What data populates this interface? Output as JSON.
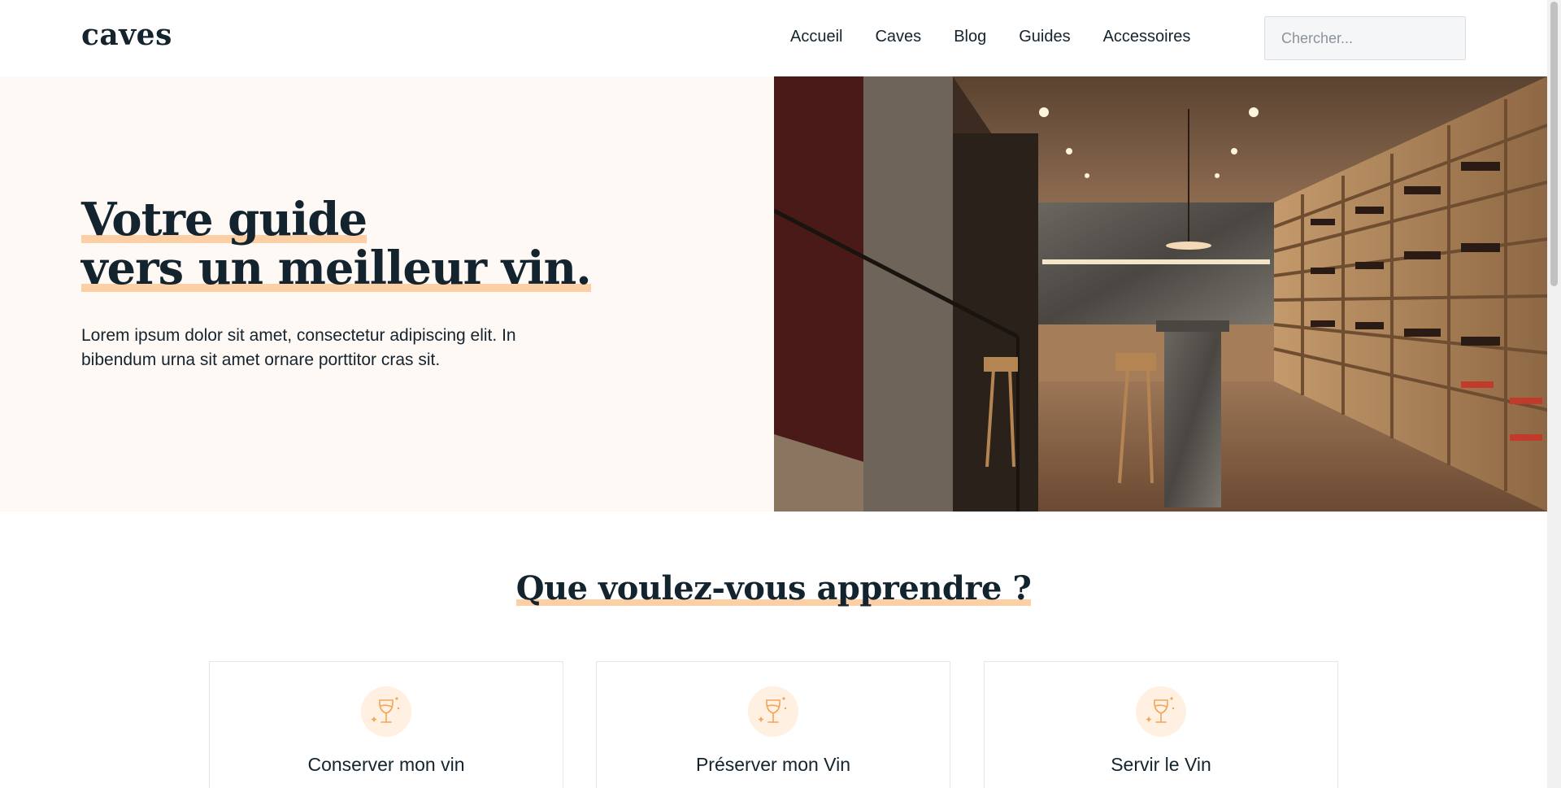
{
  "header": {
    "logo": "caves",
    "nav": [
      "Accueil",
      "Caves",
      "Blog",
      "Guides",
      "Accessoires"
    ],
    "search_placeholder": "Chercher..."
  },
  "hero": {
    "title_line1": "Votre guide",
    "title_line2": "vers un meilleur vin.",
    "text": "Lorem ipsum dolor sit amet, consectetur adipiscing elit. In bibendum urna sit amet ornare porttitor cras sit."
  },
  "section": {
    "title": "Que voulez-vous apprendre ?"
  },
  "cards": [
    {
      "title": "Conserver mon vin",
      "icon": "wine-glass-icon"
    },
    {
      "title": "Préserver mon Vin",
      "icon": "wine-glass-icon"
    },
    {
      "title": "Servir le Vin",
      "icon": "wine-glass-icon"
    }
  ],
  "colors": {
    "text": "#14242f",
    "accent_highlight": "#fcd0a4",
    "hero_bg": "#fff9f5",
    "icon_bg": "#fff0e2",
    "icon_stroke": "#f0a55a"
  }
}
